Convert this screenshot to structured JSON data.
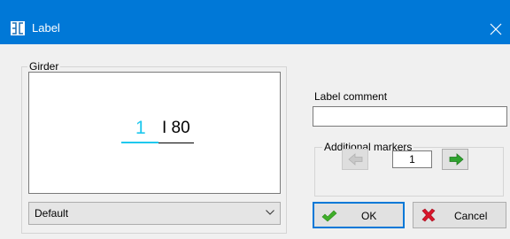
{
  "window": {
    "title": "Label",
    "app_icon": "label-app-icon",
    "close_icon": "close-icon"
  },
  "girder": {
    "group_title": "Girder",
    "preview": {
      "number": "1",
      "profile": "I 80"
    },
    "select": {
      "value": "Default",
      "icon": "chevron-down-icon"
    }
  },
  "comment": {
    "label": "Label comment",
    "value": ""
  },
  "markers": {
    "group_title": "Additional markers",
    "value": "1",
    "prev_icon": "arrow-left-icon",
    "next_icon": "arrow-right-icon"
  },
  "buttons": {
    "ok": "OK",
    "cancel": "Cancel",
    "ok_icon": "checkmark-icon",
    "cancel_icon": "red-x-icon"
  },
  "colors": {
    "titlebar": "#0078d7",
    "label_number": "#1ec8ee",
    "ok_check": "#3fae29",
    "cancel_x": "#d9162b",
    "next_arrow": "#2fa32f"
  }
}
